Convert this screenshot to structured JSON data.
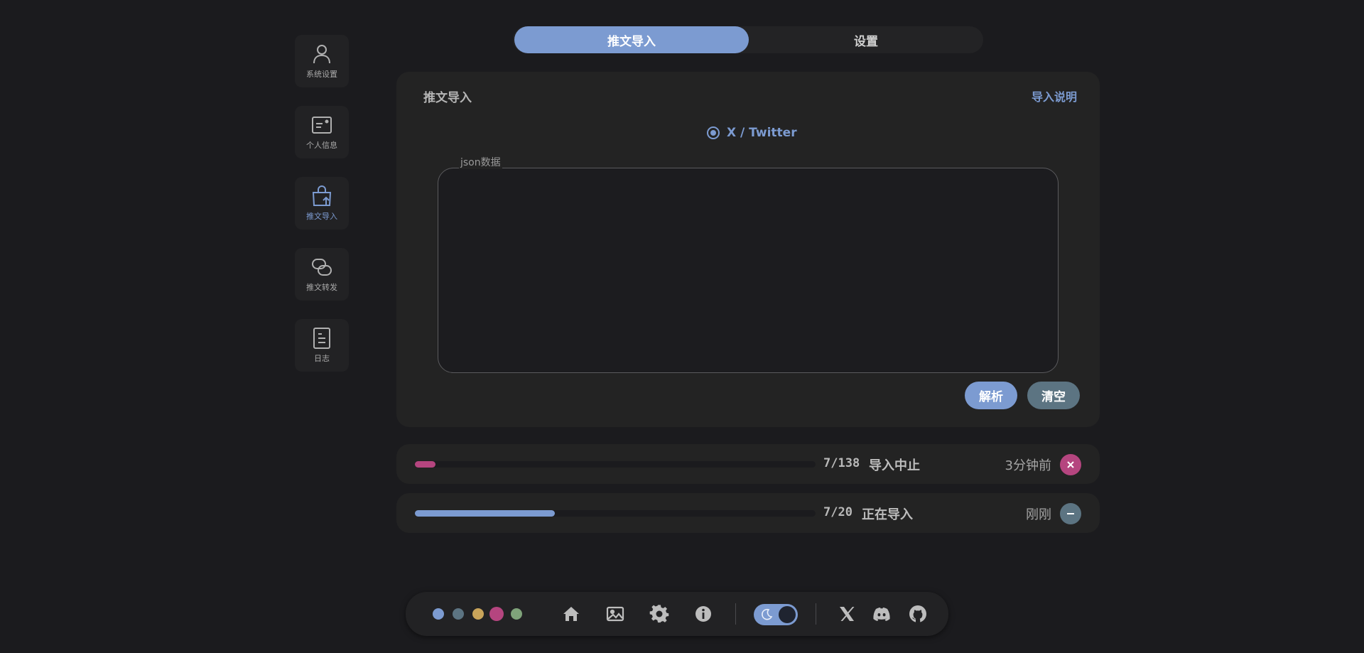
{
  "sidebar": {
    "items": [
      {
        "label": "系统设置",
        "icon": "user-icon",
        "active": false
      },
      {
        "label": "个人信息",
        "icon": "id-card-icon",
        "active": false
      },
      {
        "label": "推文导入",
        "icon": "bag-upload-icon",
        "active": true
      },
      {
        "label": "推文转发",
        "icon": "link-icon",
        "active": false
      },
      {
        "label": "日志",
        "icon": "document-icon",
        "active": false
      }
    ]
  },
  "tabs": [
    {
      "label": "推文导入",
      "active": true
    },
    {
      "label": "设置",
      "active": false
    }
  ],
  "import_card": {
    "title": "推文导入",
    "help_link": "导入说明",
    "source_option": "X / Twitter",
    "field_label": "json数据",
    "field_value": "",
    "parse_button": "解析",
    "clear_button": "清空"
  },
  "tasks": [
    {
      "count": "7/138",
      "progress": 0.0507,
      "status": "导入中止",
      "time": "3分钟前",
      "action_icon": "close-icon",
      "color": "#b5457f"
    },
    {
      "count": "7/20",
      "progress": 0.35,
      "status": "正在导入",
      "time": "刚刚",
      "action_icon": "minus-icon",
      "color": "#7c9bd1"
    }
  ],
  "dock": {
    "theme_colors": [
      "#7c9bd1",
      "#5c7482",
      "#c9a45a",
      "#b5457f",
      "#7fa37a"
    ],
    "nav_icons": [
      "home-icon",
      "image-icon",
      "gear-icon",
      "info-icon"
    ],
    "theme_toggle": {
      "icon": "moon-icon",
      "on": true
    },
    "social_icons": [
      "x-icon",
      "discord-icon",
      "github-icon"
    ]
  },
  "colors": {
    "accent": "#7c9bd1",
    "background": "#1b1b1e",
    "card": "#232323"
  }
}
